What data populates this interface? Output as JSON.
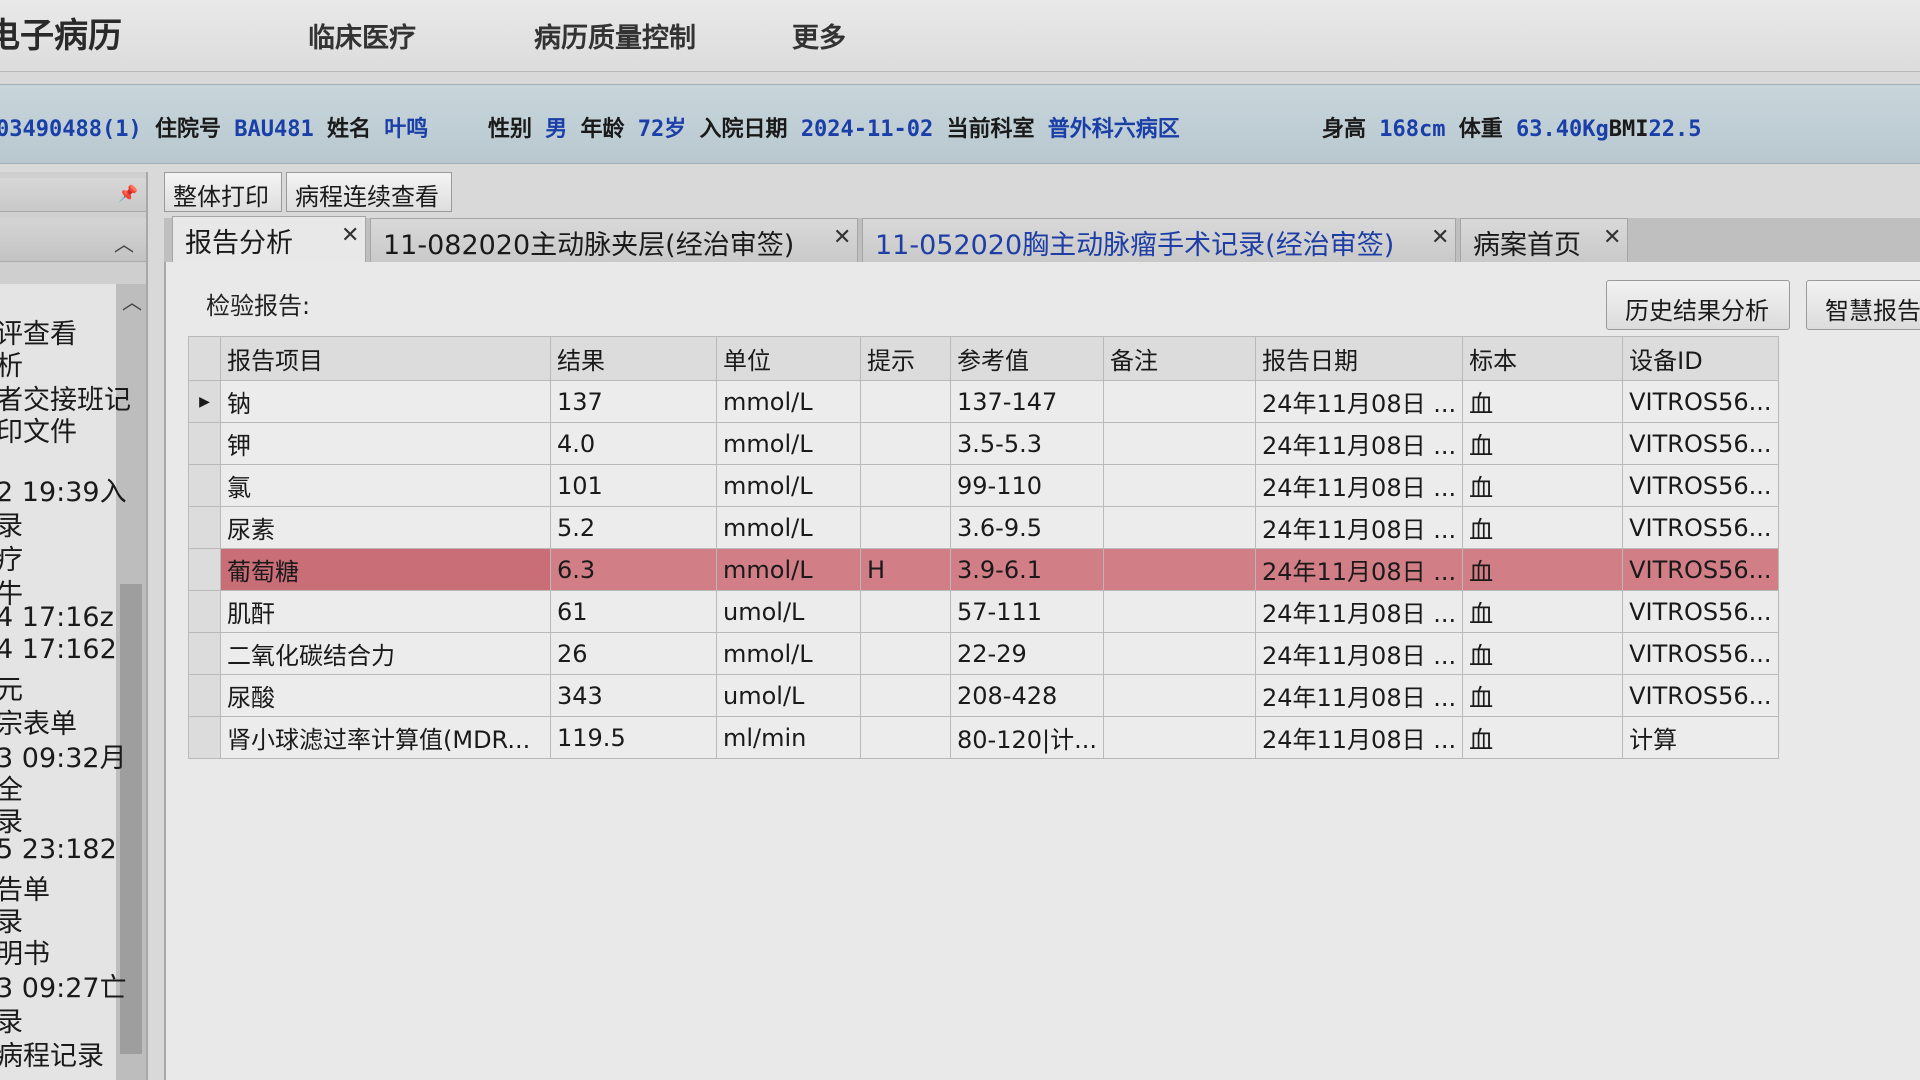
{
  "app": {
    "title": "电子病历",
    "menu": [
      "临床医疗",
      "病历质量控制",
      "更多"
    ]
  },
  "patient": {
    "id": "03490488(1)",
    "inpatient_no_label": "住院号",
    "inpatient_no": "BAU481",
    "name_label": "姓名",
    "name": "叶鸣",
    "gender_label": "性别",
    "gender": "男",
    "age_label": "年龄",
    "age": "72岁",
    "admit_label": "入院日期",
    "admit_date": "2024-11-02",
    "dept_label": "当前科室",
    "dept": "普外科六病区",
    "height_label": "身高",
    "height": "168cm",
    "weight_label": "体重",
    "weight": "63.40Kg",
    "bmi_label": "BMI",
    "bmi": "22.5"
  },
  "sidebar": {
    "items": [
      "评查看",
      "析",
      "者交接班记",
      "印文件",
      "2 19:39入",
      "录",
      "疗",
      "牛",
      "4 17:16z",
      "4 17:162",
      "元",
      "宗表单",
      "3 09:32月",
      "全",
      "录",
      "5 23:182",
      "告单",
      "录",
      "明书",
      "3 09:27亡",
      "录",
      "病程记录"
    ]
  },
  "toolbar": {
    "print_all": "整体打印",
    "continuous_view": "病程连续查看"
  },
  "tabs": [
    {
      "label": "报告分析"
    },
    {
      "label": "11-082020主动脉夹层(经治审签)"
    },
    {
      "label": "11-052020胸主动脉瘤手术记录(经治审签)"
    },
    {
      "label": "病案首页"
    }
  ],
  "panel": {
    "section_label": "检验报告:",
    "history_btn": "历史结果分析",
    "smart_btn": "智慧报告"
  },
  "table": {
    "headers": [
      "报告项目",
      "结果",
      "单位",
      "提示",
      "参考值",
      "备注",
      "报告日期",
      "标本",
      "设备ID"
    ],
    "rows": [
      {
        "name": "钠",
        "result": "137",
        "unit": "mmol/L",
        "flag": "",
        "ref": "137-147",
        "note": "",
        "date": "24年11月08日 ...",
        "specimen": "血",
        "device": "VITROS56..."
      },
      {
        "name": "钾",
        "result": "4.0",
        "unit": "mmol/L",
        "flag": "",
        "ref": "3.5-5.3",
        "note": "",
        "date": "24年11月08日 ...",
        "specimen": "血",
        "device": "VITROS56..."
      },
      {
        "name": "氯",
        "result": "101",
        "unit": "mmol/L",
        "flag": "",
        "ref": "99-110",
        "note": "",
        "date": "24年11月08日 ...",
        "specimen": "血",
        "device": "VITROS56..."
      },
      {
        "name": "尿素",
        "result": "5.2",
        "unit": "mmol/L",
        "flag": "",
        "ref": "3.6-9.5",
        "note": "",
        "date": "24年11月08日 ...",
        "specimen": "血",
        "device": "VITROS56..."
      },
      {
        "name": "葡萄糖",
        "result": "6.3",
        "unit": "mmol/L",
        "flag": "H",
        "ref": "3.9-6.1",
        "note": "",
        "date": "24年11月08日 ...",
        "specimen": "血",
        "device": "VITROS56..."
      },
      {
        "name": "肌酐",
        "result": "61",
        "unit": "umol/L",
        "flag": "",
        "ref": "57-111",
        "note": "",
        "date": "24年11月08日 ...",
        "specimen": "血",
        "device": "VITROS56..."
      },
      {
        "name": "二氧化碳结合力",
        "result": "26",
        "unit": "mmol/L",
        "flag": "",
        "ref": "22-29",
        "note": "",
        "date": "24年11月08日 ...",
        "specimen": "血",
        "device": "VITROS56..."
      },
      {
        "name": "尿酸",
        "result": "343",
        "unit": "umol/L",
        "flag": "",
        "ref": "208-428",
        "note": "",
        "date": "24年11月08日 ...",
        "specimen": "血",
        "device": "VITROS56..."
      },
      {
        "name": "肾小球滤过率计算值(MDR...",
        "result": "119.5",
        "unit": "ml/min",
        "flag": "",
        "ref": "80-120|计...",
        "note": "",
        "date": "24年11月08日 ...",
        "specimen": "血",
        "device": "计算"
      }
    ]
  },
  "colors": {
    "highlight_row": "#d27e86",
    "patient_value": "#1a3fa8",
    "tab_blue": "#1e3ea6"
  }
}
